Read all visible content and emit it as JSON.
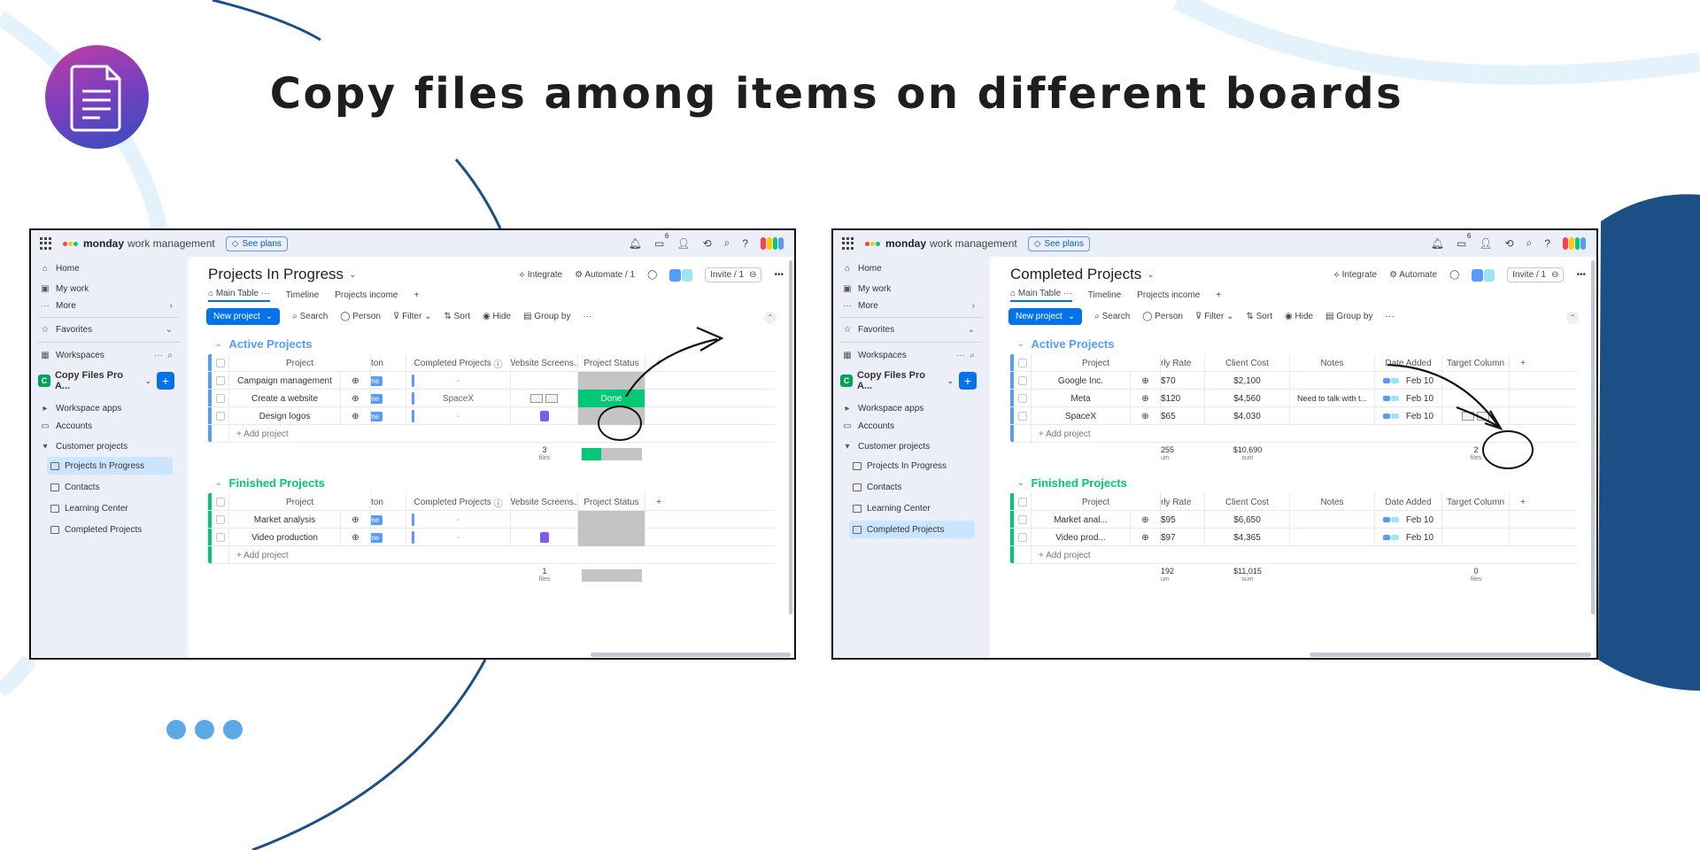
{
  "headline": "Copy files among items on different boards",
  "colors": {
    "accent": "#0073ea",
    "done": "#00c875",
    "active_group": "#579bfc",
    "finished_group": "#00c875",
    "empty_status": "#c4c4c4",
    "decor_navy": "#1b4f86",
    "decor_light": "#e3f2fb",
    "dots": "#5aa9e6"
  },
  "icons": [
    "document-icon",
    "bell-icon",
    "inbox-icon",
    "invite-icon",
    "apps-icon",
    "search-icon",
    "help-icon"
  ],
  "topbar": {
    "brand": "monday",
    "brand_sub": "work management",
    "see_plans": "See plans",
    "inbox_count": "6"
  },
  "sidebar": {
    "home": "Home",
    "my_work": "My work",
    "more": "More",
    "favorites": "Favorites",
    "workspaces": "Workspaces",
    "ws_letter": "C",
    "workspace_name": "Copy Files Pro A...",
    "workspace_apps": "Workspace apps",
    "accounts": "Accounts",
    "customer_projects": "Customer projects",
    "boards": [
      "Projects In Progress",
      "Contacts",
      "Learning Center",
      "Completed Projects"
    ]
  },
  "left_board": {
    "title": "Projects In Progress",
    "integrate": "Integrate",
    "automate": "Automate / 1",
    "invite": "Invite / 1",
    "tabs": [
      "Main Table",
      "Timeline",
      "Projects income"
    ],
    "toolbar": {
      "new": "New project",
      "search": "Search",
      "person": "Person",
      "filter": "Filter",
      "sort": "Sort",
      "hide": "Hide",
      "group_by": "Group by"
    },
    "columns": [
      "Project",
      "ton",
      "Completed Projects",
      "Website Screens...",
      "Project Status"
    ],
    "active_group": "Active Projects",
    "active_rows": [
      {
        "project": "Campaign management",
        "person": "me",
        "completed": "-",
        "status": ""
      },
      {
        "project": "Create a website",
        "person": "me",
        "completed": "SpaceX",
        "status": "Done"
      },
      {
        "project": "Design logos",
        "person": "me",
        "completed": "-",
        "status": ""
      }
    ],
    "active_summary": {
      "count": "3",
      "unit": "files"
    },
    "active_done_fraction": 0.33,
    "finished_group": "Finished Projects",
    "finished_rows": [
      {
        "project": "Market analysis",
        "person": "me",
        "completed": "-"
      },
      {
        "project": "Video production",
        "person": "me",
        "completed": "-"
      }
    ],
    "finished_summary": {
      "count": "1",
      "unit": "files"
    },
    "add_row": "+ Add project"
  },
  "right_board": {
    "title": "Completed Projects",
    "integrate": "Integrate",
    "automate": "Automate",
    "invite": "Invite / 1",
    "tabs": [
      "Main Table",
      "Timeline",
      "Projects income"
    ],
    "toolbar": {
      "new": "New project",
      "search": "Search",
      "person": "Person",
      "filter": "Filter",
      "sort": "Sort",
      "hide": "Hide",
      "group_by": "Group by"
    },
    "columns": [
      "Project",
      "rly Rate",
      "Client Cost",
      "Notes",
      "Date Added",
      "Target Column"
    ],
    "active_group": "Active Projects",
    "active_rows": [
      {
        "project": "Google Inc.",
        "rate": "$70",
        "cost": "$2,100",
        "notes": "",
        "date": "Feb 10"
      },
      {
        "project": "Meta",
        "rate": "$120",
        "cost": "$4,560",
        "notes": "Need to talk with t...",
        "date": "Feb 10"
      },
      {
        "project": "SpaceX",
        "rate": "$65",
        "cost": "$4,030",
        "notes": "",
        "date": "Feb 10"
      }
    ],
    "active_summary": {
      "rate": "255",
      "rate_unit": "um",
      "cost": "$10,690",
      "cost_unit": "sum",
      "files": "2",
      "files_unit": "files"
    },
    "finished_group": "Finished Projects",
    "finished_rows": [
      {
        "project": "Market anal...",
        "rate": "$95",
        "cost": "$6,650",
        "notes": "",
        "date": "Feb 10"
      },
      {
        "project": "Video prod...",
        "rate": "$97",
        "cost": "$4,365",
        "notes": "",
        "date": "Feb 10"
      }
    ],
    "finished_summary": {
      "rate": "192",
      "rate_unit": "um",
      "cost": "$11,015",
      "cost_unit": "sum",
      "files": "0",
      "files_unit": "files"
    },
    "add_row": "+ Add project"
  }
}
